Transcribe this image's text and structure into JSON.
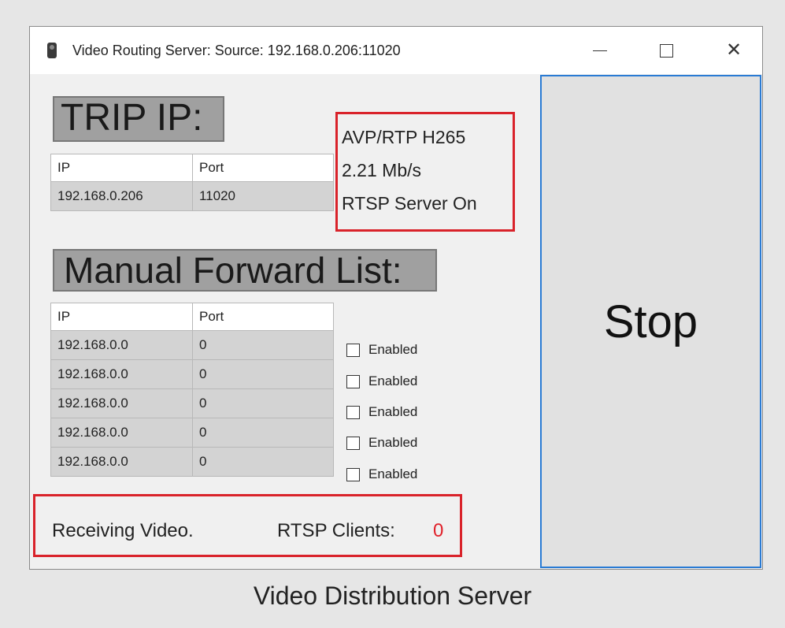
{
  "window": {
    "title": "Video Routing Server: Source: 192.168.0.206:11020",
    "icon": "app-icon"
  },
  "trip": {
    "header": "TRIP IP:",
    "columns": [
      "IP",
      "Port"
    ],
    "rows": [
      {
        "ip": "192.168.0.206",
        "port": "11020"
      }
    ]
  },
  "stream_status": {
    "protocol": "AVP/RTP H265",
    "bitrate": "2.21 Mb/s",
    "rtsp": "RTSP Server On"
  },
  "manual": {
    "header": "Manual Forward List:",
    "columns": [
      "IP",
      "Port"
    ],
    "rows": [
      {
        "ip": "192.168.0.0",
        "port": "0",
        "checkbox_label": "Enabled",
        "checked": false
      },
      {
        "ip": "192.168.0.0",
        "port": "0",
        "checkbox_label": "Enabled",
        "checked": false
      },
      {
        "ip": "192.168.0.0",
        "port": "0",
        "checkbox_label": "Enabled",
        "checked": false
      },
      {
        "ip": "192.168.0.0",
        "port": "0",
        "checkbox_label": "Enabled",
        "checked": false
      },
      {
        "ip": "192.168.0.0",
        "port": "0",
        "checkbox_label": "Enabled",
        "checked": false
      }
    ]
  },
  "footer": {
    "status": "Receiving Video.",
    "clients_label": "RTSP Clients:",
    "clients_count": "0",
    "clients_count_color": "#e0212a"
  },
  "stop_button": {
    "label": "Stop"
  },
  "caption": "Video Distribution Server",
  "colors": {
    "highlight_red": "#d9222a",
    "button_border_blue": "#2a7bd4"
  }
}
